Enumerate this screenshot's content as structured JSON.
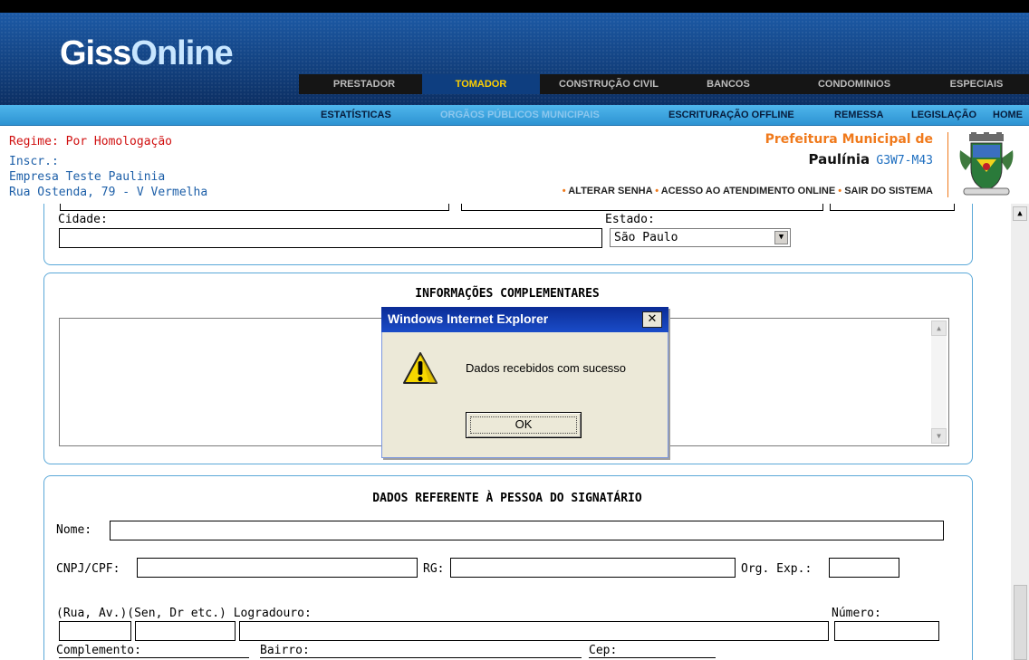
{
  "header": {
    "logo_part1": "Giss",
    "logo_part2": "Online",
    "tabs": [
      {
        "label": "PRESTADOR",
        "active": false
      },
      {
        "label": "TOMADOR",
        "active": true
      },
      {
        "label": "CONSTRUÇÃO CIVIL",
        "active": false
      },
      {
        "label": "BANCOS",
        "active": false
      },
      {
        "label": "CONDOMINIOS",
        "active": false
      },
      {
        "label": "ESPECIAIS",
        "active": false
      }
    ],
    "subnav": [
      {
        "label": "ESTATÍSTICAS",
        "disabled": false
      },
      {
        "label": "ORGÃOS PÚBLICOS MUNICIPAIS",
        "disabled": true
      },
      {
        "label": "ESCRITURAÇÃO OFFLINE",
        "disabled": false
      },
      {
        "label": "REMESSA",
        "disabled": false
      },
      {
        "label": "LEGISLAÇÃO",
        "disabled": false
      },
      {
        "label": "HOME",
        "disabled": false
      }
    ]
  },
  "company": {
    "regime": "Regime: Por Homologação",
    "inscr": "Inscr.:",
    "name": "Empresa Teste Paulinia",
    "address": "Rua Ostenda, 79 - V Vermelha"
  },
  "prefeitura": {
    "title": "Prefeitura Municipal de",
    "city": "Paulínia",
    "code": "G3W7-M43",
    "crest_icon": "city-crest-icon"
  },
  "account_links": {
    "bullet": "•",
    "change_password": "ALTERAR SENHA",
    "online_support": "ACESSO AO ATENDIMENTO ONLINE",
    "logout": "SAIR DO SISTEMA"
  },
  "address_section": {
    "city_label": "Cidade:",
    "city_value": "",
    "state_label": "Estado:",
    "state_value": "São Paulo"
  },
  "complementary": {
    "heading": "INFORMAÇÕES COMPLEMENTARES",
    "text": ""
  },
  "signatory": {
    "heading": "DADOS REFERENTE À PESSOA DO SIGNATÁRIO",
    "name_label": "Nome:",
    "cnpj_label": "CNPJ/CPF:",
    "rg_label": "RG:",
    "org_exp_label": "Org. Exp.:",
    "street_type_label": "(Rua, Av.)",
    "street_title_label": "(Sen, Dr etc.)",
    "street_label": "Logradouro:",
    "number_label": "Número:",
    "complement_label": "Complemento:",
    "district_label": "Bairro:",
    "zip_label": "Cep:"
  },
  "dialog": {
    "title": "Windows Internet Explorer",
    "close_label": "✕",
    "message": "Dados recebidos com sucesso",
    "ok_label": "OK",
    "icon": "warning-icon"
  },
  "colors": {
    "accent_orange": "#f07a1c",
    "regime_red": "#d01010",
    "text_blue": "#1d5fa8",
    "panel_border": "#5aa8d8",
    "active_tab": "#ffd000"
  }
}
